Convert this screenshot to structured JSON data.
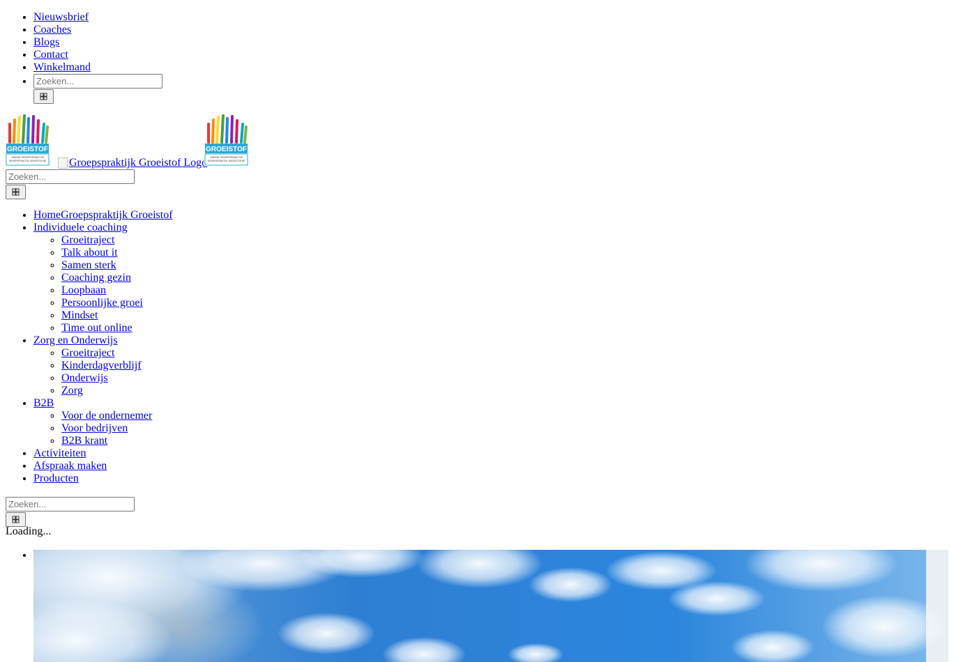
{
  "top_nav": {
    "items": [
      "Nieuwsbrief",
      "Coaches",
      "Blogs",
      "Contact",
      "Winkelmand"
    ],
    "search_placeholder": "Zoeken..."
  },
  "header": {
    "logo_alt": "Groepspraktijk Groeistof Logo",
    "logo_text": "GROEISTOF",
    "logo_subtext_1": "ONLINE GROEPSPRAKTIJK",
    "logo_subtext_2": "GROEPSPRAKTIJK-GROEISTOF.BE",
    "search_placeholder": "Zoeken..."
  },
  "main_nav": {
    "home": "Home",
    "home_title": "Groepspraktijk Groeistof",
    "sections": [
      {
        "label": "Individuele coaching",
        "children": [
          "Groeitraject",
          "Talk about it",
          "Samen sterk",
          "Coaching gezin",
          "Loopbaan",
          "Persoonlijke groei",
          "Mindset",
          "Time out online"
        ]
      },
      {
        "label": "Zorg en Onderwijs",
        "children": [
          "Groeitraject",
          "Kinderdagverblijf",
          "Onderwijs",
          "Zorg"
        ]
      },
      {
        "label": "B2B",
        "children": [
          "Voor de ondernemer",
          "Voor bedrijven",
          "B2B krant"
        ]
      }
    ],
    "extra": [
      "Activiteiten",
      "Afspraak maken",
      "Producten"
    ],
    "search_placeholder": "Zoeken..."
  },
  "status": {
    "loading": "Loading..."
  },
  "colors": {
    "link": "#0000ee",
    "sky_top": "#2f7fd6",
    "sky_bottom": "#9fc9ef"
  }
}
